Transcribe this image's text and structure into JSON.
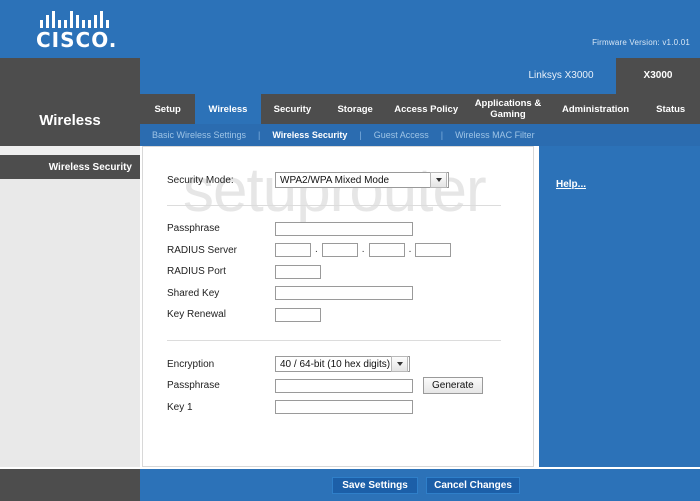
{
  "header": {
    "brand": "CISCO",
    "brand_dot": ".",
    "firmware": "Firmware Version: v1.0.01"
  },
  "model_tabs": {
    "inactive_label": "Linksys X3000",
    "active_label": "X3000"
  },
  "page": {
    "title": "Wireless",
    "section_label": "Wireless Security",
    "watermark": "setuprouter"
  },
  "main_nav": [
    {
      "label": "Setup",
      "active": false
    },
    {
      "label": "Wireless",
      "active": true
    },
    {
      "label": "Security",
      "active": false
    },
    {
      "label": "Storage",
      "active": false
    },
    {
      "label": "Access Policy",
      "active": false
    },
    {
      "label": "Applications & Gaming",
      "active": false
    },
    {
      "label": "Administration",
      "active": false
    },
    {
      "label": "Status",
      "active": false
    }
  ],
  "sub_nav": {
    "items": [
      {
        "label": "Basic Wireless Settings",
        "active": false
      },
      {
        "label": "Wireless Security",
        "active": true
      },
      {
        "label": "Guest Access",
        "active": false
      },
      {
        "label": "Wireless MAC Filter",
        "active": false
      }
    ],
    "separator": "|"
  },
  "form": {
    "security_mode": {
      "label": "Security Mode:",
      "value": "WPA2/WPA Mixed Mode"
    },
    "fields": [
      {
        "label": "Passphrase",
        "value": "",
        "type": "text"
      },
      {
        "label": "RADIUS Server",
        "value": "",
        "type": "ip"
      },
      {
        "label": "RADIUS Port",
        "value": "",
        "type": "short"
      },
      {
        "label": "Shared Key",
        "value": "",
        "type": "text"
      },
      {
        "label": "Key Renewal",
        "value": "",
        "type": "short"
      }
    ],
    "encryption": {
      "label": "Encryption",
      "value": "40 / 64-bit (10 hex digits)"
    },
    "passphrase2": {
      "label": "Passphrase",
      "value": "",
      "generate_label": "Generate"
    },
    "key1": {
      "label": "Key 1",
      "value": ""
    },
    "ip_separator": "."
  },
  "help": {
    "link_label": "Help..."
  },
  "footer": {
    "save_label": "Save Settings",
    "cancel_label": "Cancel Changes"
  },
  "colors": {
    "header_blue": "#2c72b8",
    "nav_gray": "#4d4d4d",
    "subnav_blue": "#2b6cb0",
    "button_blue": "#1c5fa8"
  }
}
